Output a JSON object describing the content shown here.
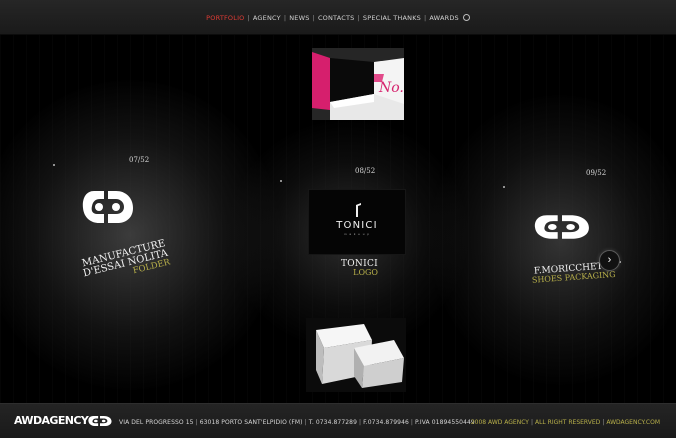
{
  "nav": {
    "items": [
      "Portfolio",
      "Agency",
      "News",
      "Contacts",
      "Special Thanks",
      "Awards"
    ],
    "active_index": 0,
    "separator": "|",
    "icons": [
      "power-icon"
    ]
  },
  "carousel": {
    "left": {
      "counter": "07/52",
      "title_line1": "Manufacture",
      "title_line2": "d'essai nolita",
      "subtitle": "Folder"
    },
    "center": {
      "counter": "08/52",
      "title": "Tonici",
      "subtitle": "Logo",
      "logo_word": "TONICI",
      "logo_sub": "m a k e u p"
    },
    "right": {
      "counter": "09/52",
      "title": "F.Moricchetti",
      "subtitle": "Shoes packaging"
    },
    "top_thumb_text": "No.!",
    "next_icon": "chevron-right-icon"
  },
  "footer": {
    "logo_text": "AWDAGENCY",
    "address": [
      "Via del progresso 15",
      "63018 Porto Sant'Elpidio (FM)",
      "T. 0734.877289",
      "F.0734.879946",
      "P.IVA 01894550449"
    ],
    "copyright": [
      "2008 AWD Agency",
      "All right reserved",
      "awdagency.com"
    ]
  },
  "colors": {
    "accent_red": "#e23c35",
    "accent_olive": "#b8b04a",
    "background": "#000000"
  }
}
